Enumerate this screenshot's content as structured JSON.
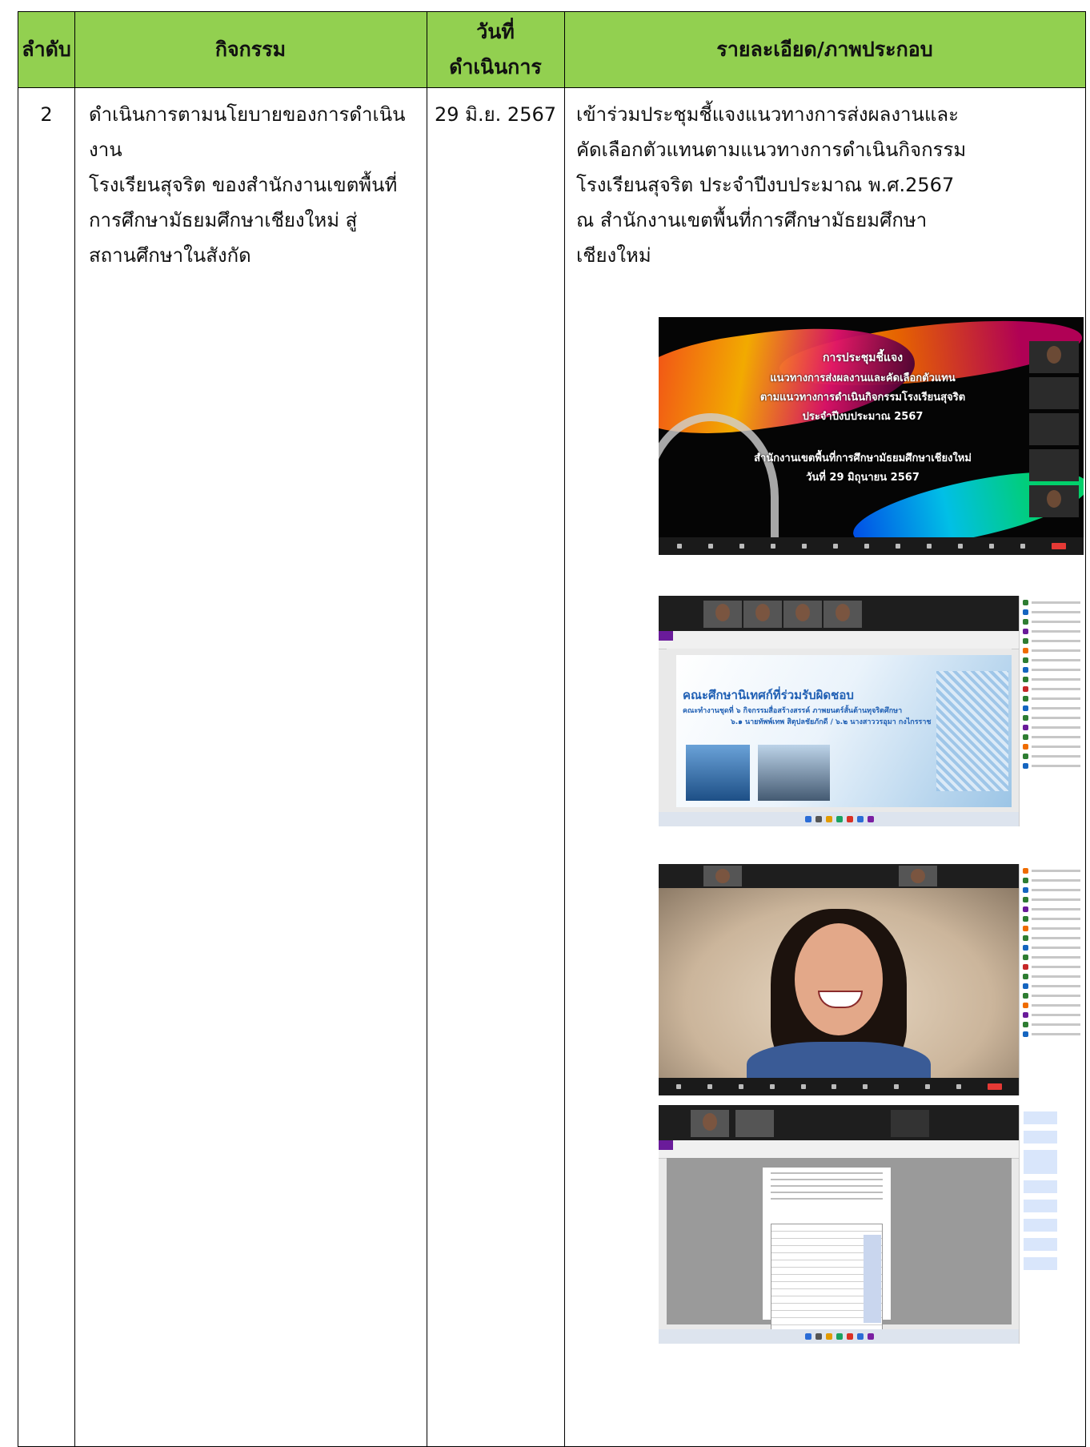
{
  "table": {
    "headers": {
      "order": "ลำดับ",
      "activity": "กิจกรรม",
      "date_line1": "วันที่",
      "date_line2": "ดำเนินการ",
      "details": "รายละเอียด/ภาพประกอบ"
    },
    "row": {
      "order": "2",
      "activity_lines": [
        "ดำเนินการตามนโยบายของการดำเนินงาน",
        "โรงเรียนสุจริต ของสำนักงานเขตพื้นที่",
        "การศึกษามัธยมศึกษาเชียงใหม่ สู่",
        "สถานศึกษาในสังกัด"
      ],
      "date": "29 มิ.ย. 2567",
      "detail_lines": [
        "เข้าร่วมประชุมชี้แจงแนวทางการส่งผลงานและ",
        "คัดเลือกตัวแทนตามแนวทางการดำเนินกิจกรรม",
        "โรงเรียนสุจริต ประจำปีงบประมาณ พ.ศ.2567",
        "ณ สำนักงานเขตพื้นที่การศึกษามัธยมศึกษา",
        "เชียงใหม่"
      ]
    }
  },
  "screenshot1": {
    "title_lines": [
      "การประชุมชี้แจง",
      "แนวทางการส่งผลงานและคัดเลือกตัวแทน",
      "ตามแนวทางการดำเนินกิจกรรมโรงเรียนสุจริต",
      "ประจำปีงบประมาณ 2567",
      "",
      "สำนักงานเขตพื้นที่การศึกษามัธยมศึกษาเชียงใหม่",
      "วันที่ 29 มิถุนายน 2567"
    ]
  },
  "screenshot2": {
    "slide_heading": "คณะศึกษานิเทศก์ที่ร่วมรับผิดชอบ",
    "slide_line1": "คณะทำงานชุดที่ ๖ กิจกรรมสื่อสร้างสรรค์ ภาพยนตร์สั้นต้านทุจริตศึกษา",
    "slide_line2": "๖.๑ นายทัพพ์เทพ สิตุปลชัยภักดี / ๖.๒ นางสาววรอุมา กงไกรราช"
  },
  "colors": {
    "header_bg": "#92d050",
    "border": "#000000"
  }
}
